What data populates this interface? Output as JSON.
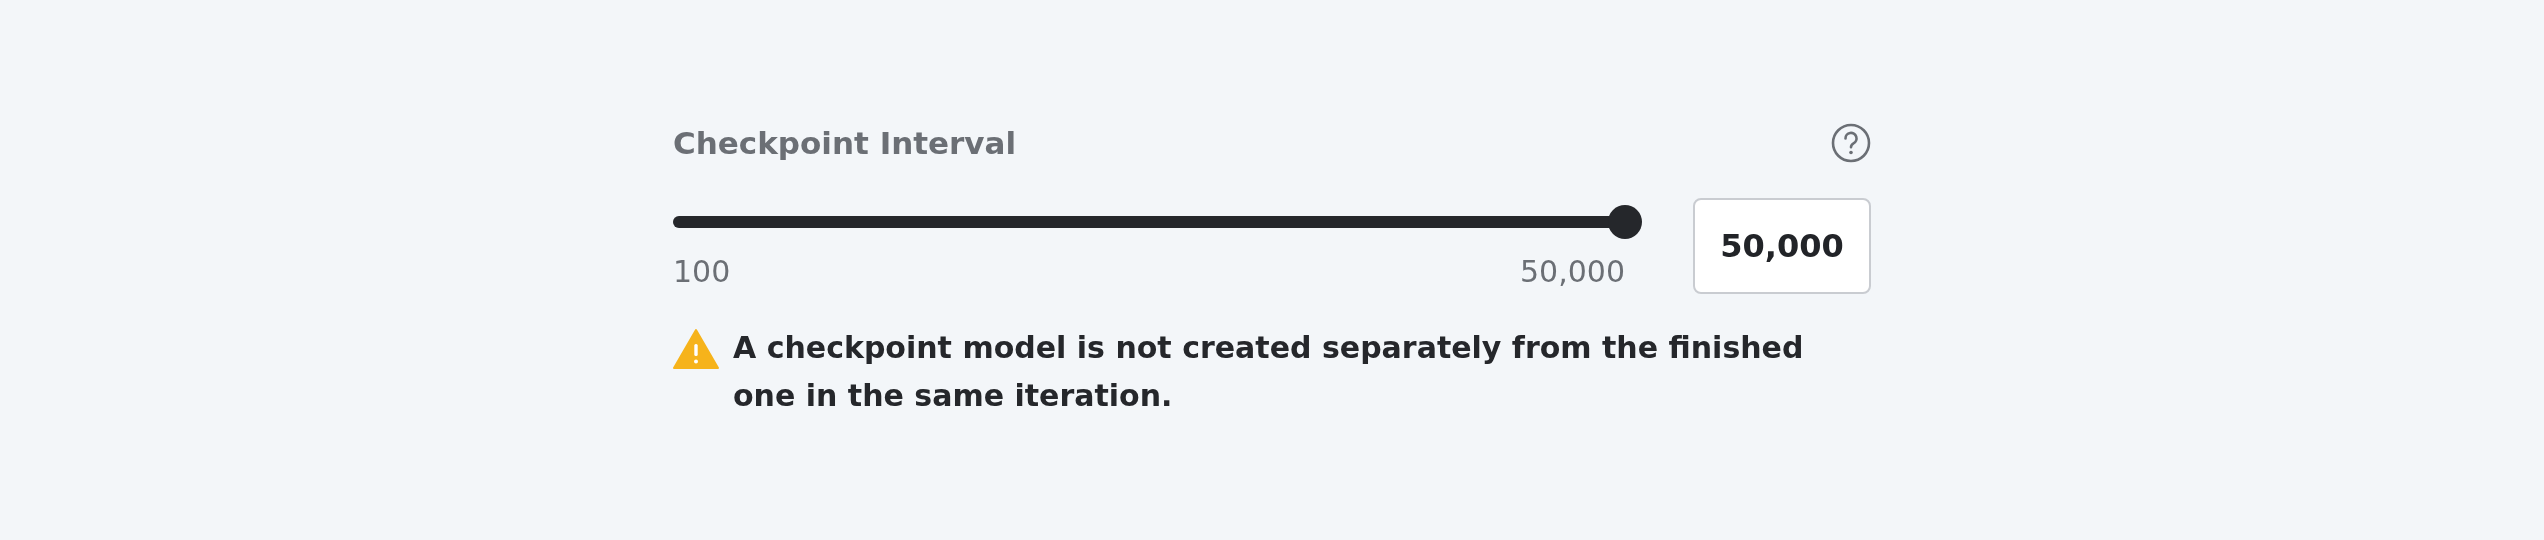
{
  "field": {
    "label": "Checkpoint Interval"
  },
  "slider": {
    "level": 1,
    "min_label": "100",
    "max_label": "50,000"
  },
  "value_field": {
    "value": "50,000"
  },
  "warning": {
    "kind": "warning",
    "text": "A checkpoint model is not created separately from the finished one in the same iteration."
  }
}
